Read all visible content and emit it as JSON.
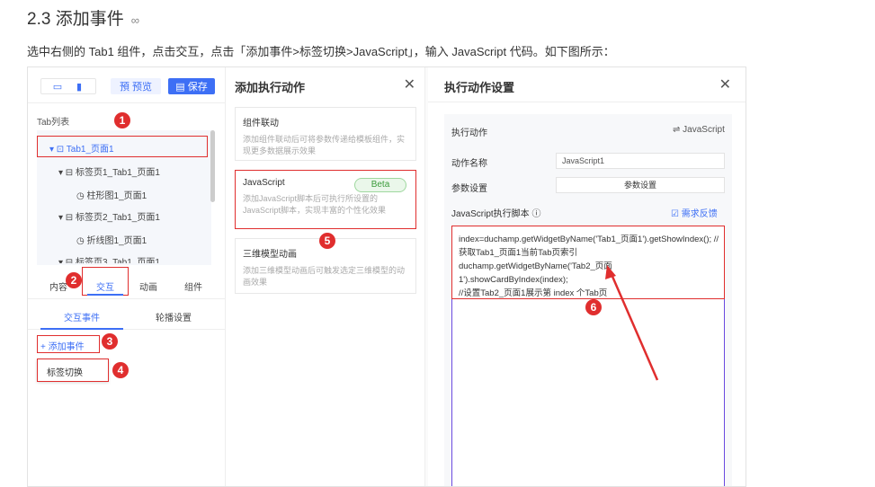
{
  "heading": {
    "title": "2.3 添加事件",
    "anchor": "∞"
  },
  "description": "选中右侧的 Tab1 组件，点击交互，点击「添加事件>标签切换>JavaScript」，输入 JavaScript 代码。如下图所示：",
  "left": {
    "topbar": {
      "device_desktop": "▭",
      "device_mobile": "▮",
      "preview": "預 预览",
      "save": "▤ 保存"
    },
    "tablist_label": "Tab列表",
    "tree": [
      "▾ ⊡ Tab1_页面1",
      "▾ ⊟ 标签页1_Tab1_页面1",
      "◷ 柱形图1_页面1",
      "▾ ⊟ 标签页2_Tab1_页面1",
      "◷ 折线图1_页面1",
      "▾ ⊟ 标签页3_Tab1_页面1"
    ],
    "tabs": [
      "内容",
      "交互",
      "动画",
      "组件"
    ],
    "subtabs": [
      "交互事件",
      "轮播设置"
    ],
    "add_event": "+ 添加事件",
    "menu_item": "标签切换"
  },
  "middle": {
    "title": "添加执行动作",
    "close": "✕",
    "cards": [
      {
        "title": "组件联动",
        "desc": "添加组件联动后可将参数传递给模板组件，实现更多数据展示效果"
      },
      {
        "title": "JavaScript",
        "badge": "Beta",
        "desc": "添加JavaScript脚本后可执行所设置的JavaScript脚本，实现丰富的个性化效果"
      },
      {
        "title": "三维模型动画",
        "desc": "添加三维模型动画后可触发选定三维模型的动画效果"
      }
    ]
  },
  "right": {
    "title": "执行动作设置",
    "close": "✕",
    "action_label": "执行动作",
    "action_value": "⇌ JavaScript",
    "name_label": "动作名称",
    "name_value": "JavaScript1",
    "param_label": "参数设置",
    "param_button": "参数设置",
    "script_label": "JavaScript执行脚本 ⓘ",
    "feedback": "☑ 需求反馈",
    "code_lines": [
      "index=duchamp.getWidgetByName('Tab1_页面1').getShowIndex(); //",
      "获取Tab1_页面1当前Tab页索引",
      "duchamp.getWidgetByName('Tab2_页面1').showCardByIndex(index);",
      "//设置Tab2_页面1展示第 index 个Tab页"
    ]
  },
  "badges": [
    "1",
    "2",
    "3",
    "4",
    "5",
    "6"
  ],
  "colors": {
    "accent": "#3d6ff5",
    "highlight_red": "#e02e2e",
    "code_border": "#6a4ae0"
  }
}
